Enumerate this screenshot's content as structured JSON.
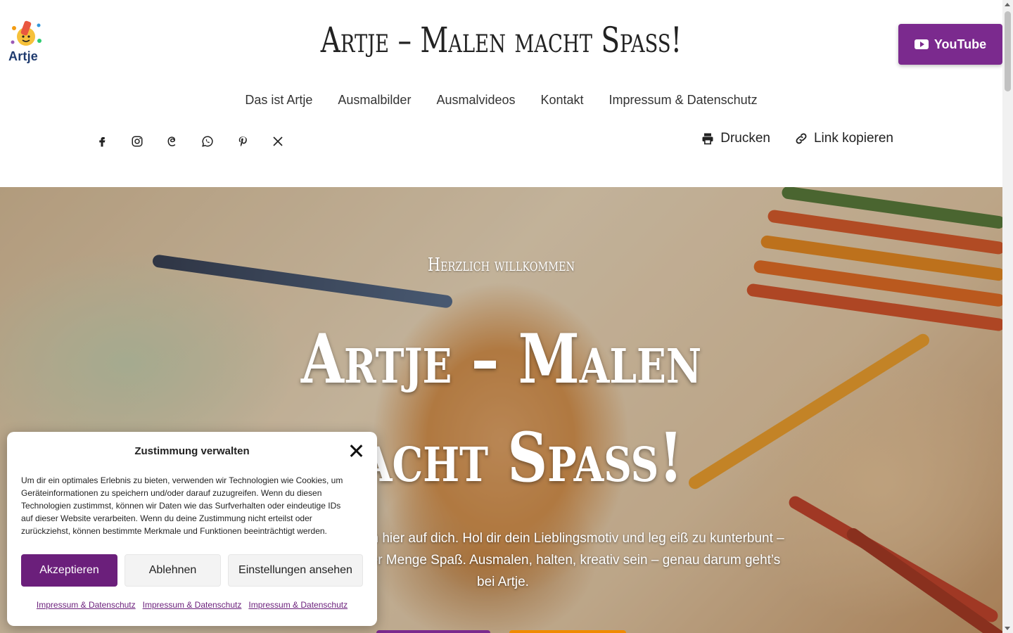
{
  "header": {
    "logo_text": "Artje",
    "site_title": "Artje – Malen macht Spaß!",
    "youtube_label": "YouTube"
  },
  "nav": {
    "items": [
      {
        "label": "Das ist Artje"
      },
      {
        "label": "Ausmalbilder"
      },
      {
        "label": "Ausmalvideos"
      },
      {
        "label": "Kontakt"
      },
      {
        "label": "Impressum & Datenschutz"
      }
    ]
  },
  "social_icons": [
    "facebook-icon",
    "instagram-icon",
    "threads-icon",
    "whatsapp-icon",
    "pinterest-icon",
    "x-icon"
  ],
  "tools": {
    "print_label": "Drucken",
    "copy_link_label": "Link kopieren"
  },
  "hero": {
    "kicker": "Herzlich willkommen",
    "title": "Artje – Malen macht Spaß!",
    "text": "große Kreativköpfe warten hier auf dich. Hol dir dein Lieblingsmotiv und leg eiß zu kunterbunt – ganz einfach und mit jeder Menge Spaß. Ausmalen, halten, kreativ sein – genau darum geht’s bei Artje."
  },
  "consent": {
    "title": "Zustimmung verwalten",
    "body": "Um dir ein optimales Erlebnis zu bieten, verwenden wir Technologien wie Cookies, um Geräteinformationen zu speichern und/oder darauf zuzugreifen. Wenn du diesen Technologien zustimmst, können wir Daten wie das Surfverhalten oder eindeutige IDs auf dieser Website verarbeiten. Wenn du deine Zustimmung nicht erteilst oder zurückziehst, können bestimmte Merkmale und Funktionen beeinträchtigt werden.",
    "accept_label": "Akzeptieren",
    "deny_label": "Ablehnen",
    "settings_label": "Einstellungen ansehen",
    "links": [
      "Impressum & Datenschutz",
      "Impressum & Datenschutz",
      "Impressum & Datenschutz"
    ]
  },
  "colors": {
    "brand_purple": "#7b2a8e",
    "accent_orange": "#f08a00"
  }
}
